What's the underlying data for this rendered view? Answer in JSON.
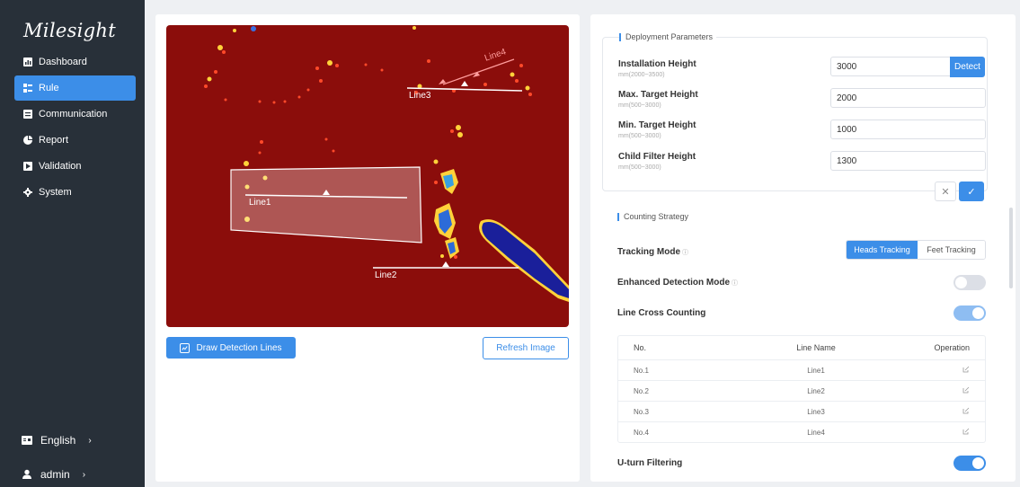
{
  "brand": {
    "logo": "Milesight"
  },
  "sidebar": {
    "items": [
      {
        "label": "Dashboard",
        "icon": "dashboard-icon"
      },
      {
        "label": "Rule",
        "icon": "rule-icon",
        "active": true
      },
      {
        "label": "Communication",
        "icon": "communication-icon"
      },
      {
        "label": "Report",
        "icon": "report-icon"
      },
      {
        "label": "Validation",
        "icon": "validation-icon"
      },
      {
        "label": "System",
        "icon": "gear-icon"
      }
    ],
    "language": "English",
    "user": "admin"
  },
  "heatmap": {
    "lines": [
      "Line1",
      "Line2",
      "Line3",
      "Line4"
    ]
  },
  "actions": {
    "draw_lines": "Draw Detection Lines",
    "refresh": "Refresh Image"
  },
  "deployment": {
    "title": "Deployment Parameters",
    "params": [
      {
        "label": "Installation Height",
        "range": "mm(2000~3500)",
        "value": "3000"
      },
      {
        "label": "Max. Target Height",
        "range": "mm(500~3000)",
        "value": "2000"
      },
      {
        "label": "Min. Target Height",
        "range": "mm(500~3000)",
        "value": "1000"
      },
      {
        "label": "Child Filter Height",
        "range": "mm(500~3000)",
        "value": "1300"
      }
    ],
    "detect_label": "Detect"
  },
  "counting": {
    "title": "Counting Strategy",
    "tracking_mode_label": "Tracking Mode",
    "tracking_options": [
      "Heads Tracking",
      "Feet Tracking"
    ],
    "tracking_selected": "Heads Tracking",
    "enhanced_label": "Enhanced Detection Mode",
    "enhanced_on": false,
    "line_cross_label": "Line Cross Counting",
    "line_cross_on": true,
    "uturn_label": "U-turn Filtering",
    "uturn_on": true
  },
  "lines_table": {
    "headers": [
      "No.",
      "Line Name",
      "Operation"
    ],
    "rows": [
      {
        "no": "No.1",
        "name": "Line1"
      },
      {
        "no": "No.2",
        "name": "Line2"
      },
      {
        "no": "No.3",
        "name": "Line3"
      },
      {
        "no": "No.4",
        "name": "Line4"
      }
    ]
  },
  "colors": {
    "accent": "#3c8ee8",
    "sidebar_bg": "#283039",
    "heatmap_bg": "#8b0d0b"
  }
}
